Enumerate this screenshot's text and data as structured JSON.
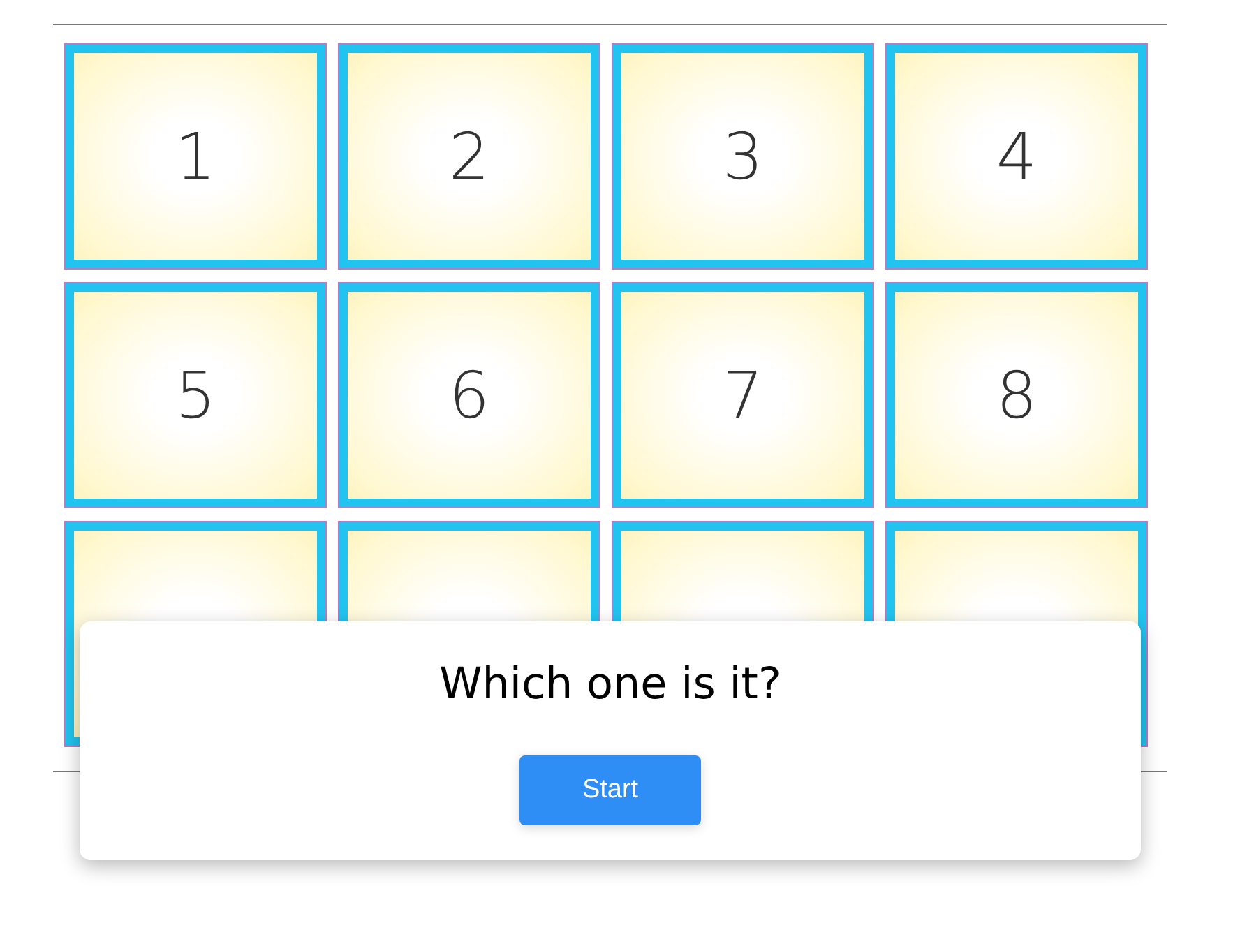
{
  "cards": [
    {
      "kind": "number",
      "label": "1"
    },
    {
      "kind": "number",
      "label": "2"
    },
    {
      "kind": "number",
      "label": "3"
    },
    {
      "kind": "number",
      "label": "4"
    },
    {
      "kind": "number",
      "label": "5"
    },
    {
      "kind": "number",
      "label": "6"
    },
    {
      "kind": "number",
      "label": "7"
    },
    {
      "kind": "number",
      "label": "8"
    },
    {
      "kind": "covered"
    },
    {
      "kind": "covered"
    },
    {
      "kind": "covered"
    },
    {
      "kind": "covered"
    }
  ],
  "dialog": {
    "title": "Which one is it?",
    "button": "Start"
  }
}
